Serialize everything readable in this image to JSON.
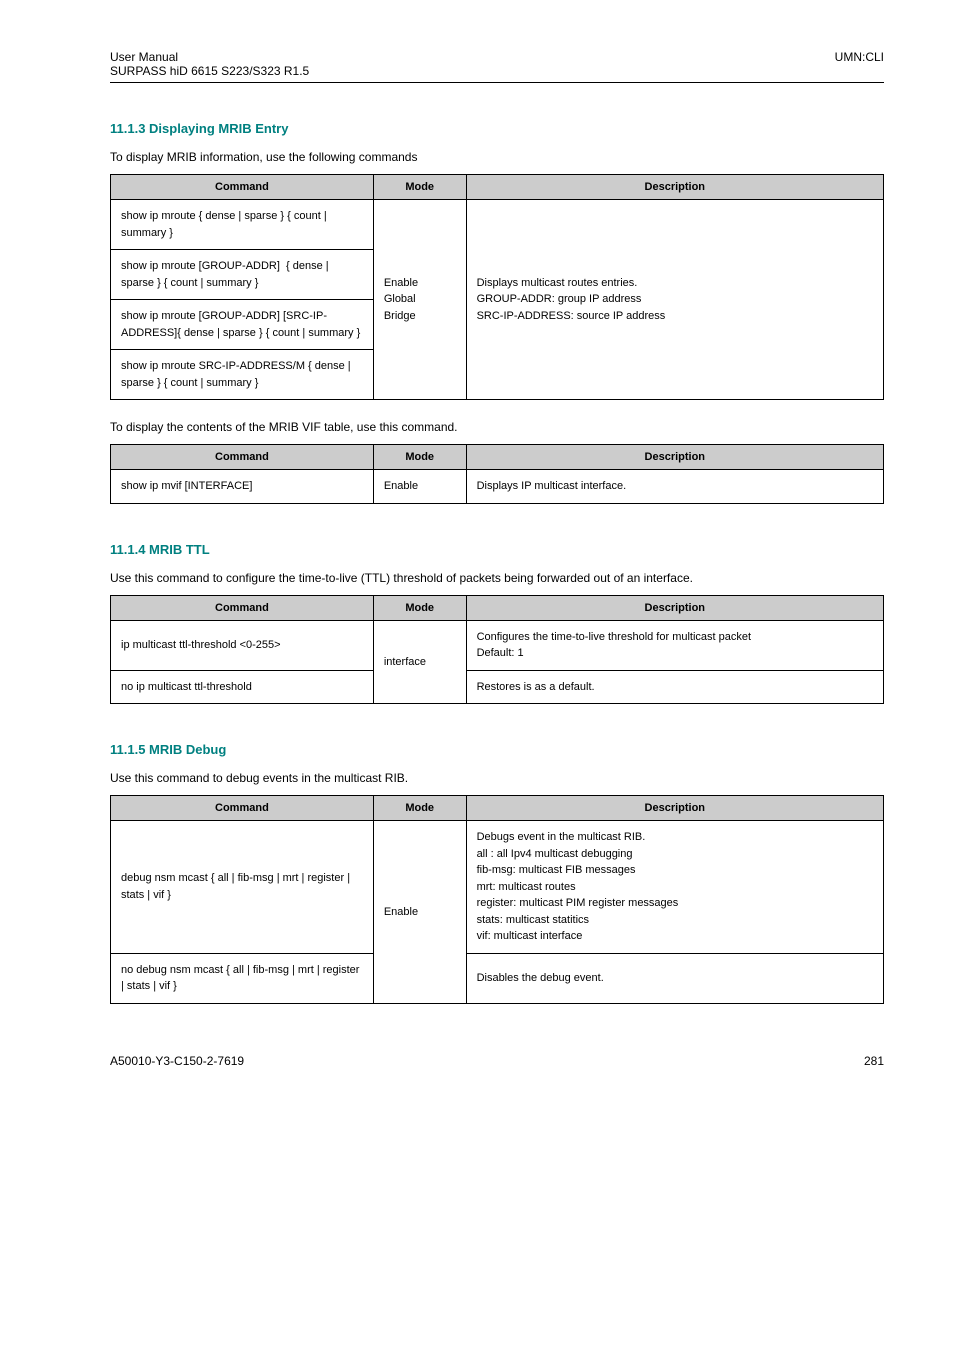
{
  "header": {
    "left1": "User  Manual",
    "left2": "SURPASS hiD 6615 S223/S323 R1.5",
    "right": "UMN:CLI"
  },
  "section1": {
    "heading": "11.1.3  Displaying MRIB Entry",
    "intro": "To display MRIB information, use the following commands",
    "table": {
      "th_cmd": "Command",
      "th_mode": "Mode",
      "th_desc": "Description",
      "rows": [
        "show ip mroute { dense | sparse } { count | summary }",
        "show ip mroute [GROUP-ADDR]  { dense | sparse } { count | summary }",
        "show ip mroute [GROUP-ADDR] [SRC-IP-ADDRESS]{ dense | sparse } { count | summary }",
        "show ip mroute SRC-IP-ADDRESS/M { dense | sparse } { count | summary }"
      ],
      "mode": "Enable\nGlobal\nBridge",
      "desc": "Displays multicast routes entries.\nGROUP-ADDR: group IP address\nSRC-IP-ADDRESS: source IP address"
    },
    "intro2": "To display the contents of the MRIB VIF table, use this command.",
    "table2": {
      "th_cmd": "Command",
      "th_mode": "Mode",
      "th_desc": "Description",
      "row_cmd": "show ip mvif [INTERFACE]",
      "row_mode": "Enable",
      "row_desc": "Displays IP multicast interface."
    }
  },
  "section2": {
    "heading": "11.1.4  MRIB TTL",
    "intro": "Use this command to configure the time-to-live (TTL) threshold of packets being forwarded out of an interface.",
    "table": {
      "th_cmd": "Command",
      "th_mode": "Mode",
      "th_desc": "Description",
      "row1_cmd": "ip multicast ttl-threshold <0-255>",
      "row1_desc": "Configures the time-to-live threshold for multicast packet\nDefault: 1",
      "row2_cmd": "no ip multicast ttl-threshold",
      "row2_desc": "Restores is as a default.",
      "mode": "interface"
    }
  },
  "section3": {
    "heading": "11.1.5  MRIB Debug",
    "intro": "Use this command to debug events in the multicast RIB.",
    "table": {
      "th_cmd": "Command",
      "th_mode": "Mode",
      "th_desc": "Description",
      "row1_cmd": "debug nsm mcast { all | fib-msg | mrt | register | stats | vif }",
      "row1_desc": "Debugs event in the multicast RIB.\nall : all Ipv4 multicast debugging\nfib-msg: multicast FIB messages\nmrt: multicast routes\nregister: multicast PIM register messages\nstats: multicast statitics\nvif: multicast interface",
      "row2_cmd": "no debug nsm mcast { all | fib-msg | mrt | register | stats | vif }",
      "row2_desc": "Disables the debug event.",
      "mode": "Enable"
    }
  },
  "footer": {
    "left": "A50010-Y3-C150-2-7619",
    "right": "281"
  }
}
